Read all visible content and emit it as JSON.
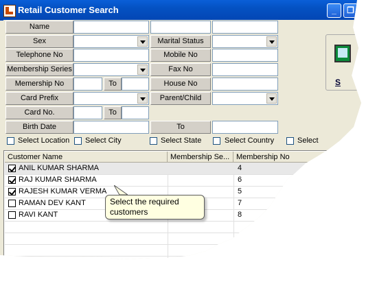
{
  "window": {
    "title": "Retail Customer Search",
    "minimize": "_",
    "close_glyph": "❐"
  },
  "form": {
    "name_label": "Name",
    "sex_label": "Sex",
    "marital_label": "Marital Status",
    "telephone_label": "Telephone No",
    "mobile_label": "Mobile No",
    "series_label": "Membership Series",
    "fax_label": "Fax No",
    "memno_label": "Memership No",
    "to_label": "To",
    "house_label": "House No",
    "card_prefix_label": "Card Prefix",
    "parent_label": "Parent/Child",
    "cardno_label": "Card No.",
    "birth_label": "Birth Date",
    "birth_to_label": "To"
  },
  "search_button": {
    "label": "S"
  },
  "filters": [
    {
      "label": "Select Location",
      "checked": false
    },
    {
      "label": "Select City",
      "checked": false
    },
    {
      "label": "Select State",
      "checked": false
    },
    {
      "label": "Select Country",
      "checked": false
    },
    {
      "label": "Select",
      "checked": false
    }
  ],
  "grid": {
    "columns": [
      "Customer Name",
      "Membership Se...",
      "Membership No"
    ],
    "rows": [
      {
        "name": "ANIL KUMAR SHARMA",
        "series": "",
        "number": "4",
        "checked": true
      },
      {
        "name": "RAJ KUMAR SHARMA",
        "series": "",
        "number": "6",
        "checked": true
      },
      {
        "name": "RAJESH KUMAR VERMA",
        "series": "",
        "number": "5",
        "checked": true
      },
      {
        "name": "RAMAN DEV KANT",
        "series": "",
        "number": "7",
        "checked": false
      },
      {
        "name": "RAVI KANT",
        "series": "",
        "number": "8",
        "checked": false
      }
    ]
  },
  "callout": {
    "text": "Select the required customers"
  }
}
